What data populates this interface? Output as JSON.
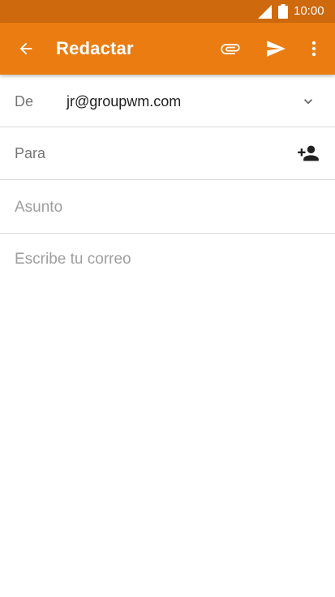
{
  "status_bar": {
    "time": "10:00",
    "signal_icon": "cell-signal-icon",
    "battery_icon": "battery-icon"
  },
  "app_bar": {
    "title": "Redactar",
    "background_color": "#ea7c11",
    "status_color": "#cf690e",
    "icons": {
      "back": "arrow-left-icon",
      "attach": "paperclip-icon",
      "send": "send-icon",
      "more": "more-vertical-icon"
    }
  },
  "compose": {
    "from_label": "De",
    "from_value": "jr@groupwm.com",
    "to_label": "Para",
    "to_value": "",
    "subject_placeholder": "Asunto",
    "subject_value": "",
    "body_placeholder": "Escribe tu correo",
    "body_value": ""
  }
}
